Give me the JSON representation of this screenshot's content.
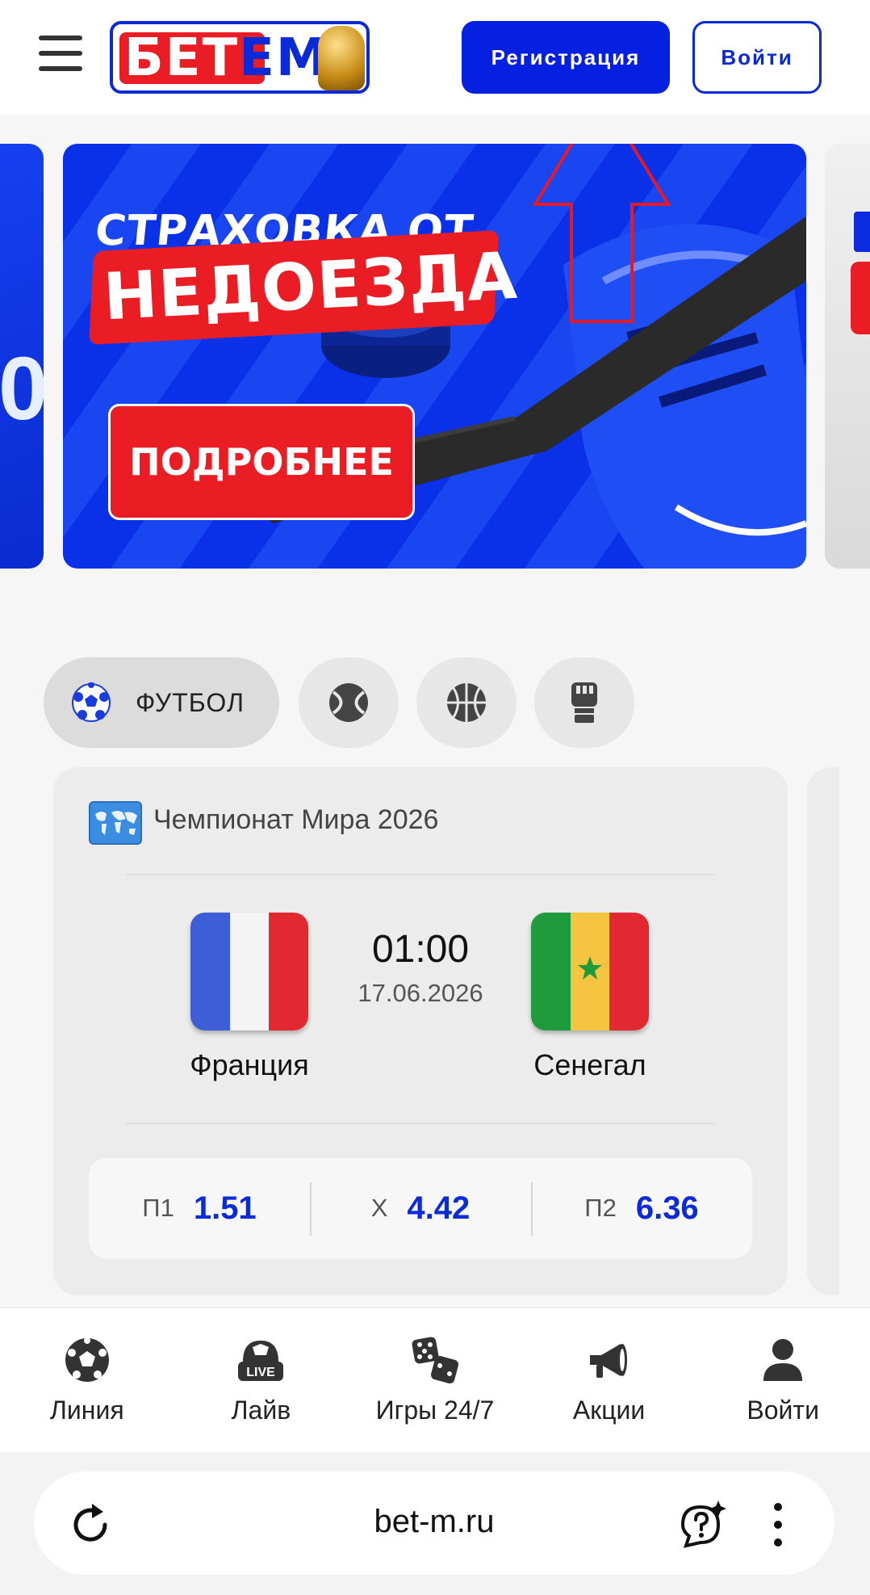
{
  "header": {
    "logo_text_a": "БЕТ",
    "logo_text_b": "ЕМ",
    "register_label": "Регистрация",
    "login_label": "Войти"
  },
  "banner": {
    "title_line1": "СТРАХОВКА ОТ",
    "title_line2": "НЕДОЕЗДА",
    "cta_label": "ПОДРОБНЕЕ"
  },
  "sports": {
    "active_label": "ФУТБОЛ",
    "items": [
      {
        "icon": "football-icon",
        "label": "ФУТБОЛ"
      },
      {
        "icon": "tennis-icon"
      },
      {
        "icon": "basketball-icon"
      },
      {
        "icon": "mma-glove-icon"
      }
    ]
  },
  "match": {
    "league": "Чемпионат Мира 2026",
    "time": "01:00",
    "date": "17.06.2026",
    "home_team": "Франция",
    "away_team": "Сенегал",
    "odds": [
      {
        "label": "П1",
        "value": "1.51"
      },
      {
        "label": "X",
        "value": "4.42"
      },
      {
        "label": "П2",
        "value": "6.36"
      }
    ]
  },
  "bottom_nav": {
    "items": [
      {
        "icon": "soccer-ball-icon",
        "label": "Линия"
      },
      {
        "icon": "live-icon",
        "label": "Лайв"
      },
      {
        "icon": "dice-icon",
        "label": "Игры 24/7"
      },
      {
        "icon": "megaphone-icon",
        "label": "Акции"
      },
      {
        "icon": "user-icon",
        "label": "Войти"
      }
    ]
  },
  "browser": {
    "url": "bet-m.ru"
  },
  "colors": {
    "brand_blue": "#0520e0",
    "brand_red": "#ea1c24",
    "odds_blue": "#0b2ad8"
  }
}
